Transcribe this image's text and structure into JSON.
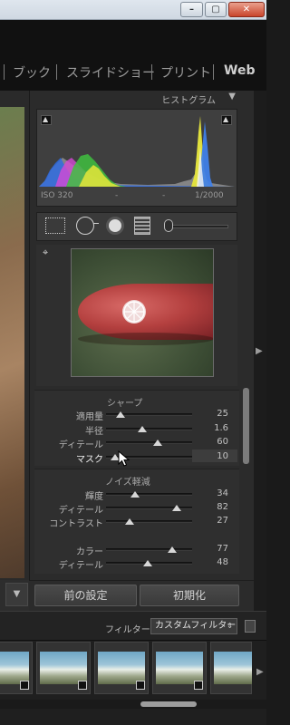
{
  "window": {
    "minimize_glyph": "–",
    "maximize_glyph": "▢",
    "close_glyph": "✕"
  },
  "modules": [
    {
      "label": "ブック"
    },
    {
      "label": "スライドショー"
    },
    {
      "label": "プリント"
    },
    {
      "label": "Web"
    }
  ],
  "histogram": {
    "title": "ヒストグラム",
    "collapse_glyph": "▼",
    "iso": "ISO 320",
    "focal": "-",
    "aperture": "-",
    "shutter": "1/2000",
    "clip_glyph": "▲"
  },
  "tools": {
    "icons": [
      "crop-icon",
      "spot-removal-icon",
      "red-eye-icon",
      "graduated-filter-icon",
      "adjustment-brush-icon"
    ]
  },
  "detail": {
    "target_glyph": "⌖"
  },
  "sharpen": {
    "title": "シャープ",
    "sliders": [
      {
        "label": "適用量",
        "value": "25",
        "position": 0.17
      },
      {
        "label": "半径",
        "value": "1.6",
        "position": 0.42
      },
      {
        "label": "ディテール",
        "value": "60",
        "position": 0.6
      },
      {
        "label": "マスク",
        "value": "10",
        "position": 0.1
      }
    ]
  },
  "noise": {
    "title": "ノイズ軽減",
    "sliders": [
      {
        "label": "輝度",
        "value": "34",
        "position": 0.34
      },
      {
        "label": "ディテール",
        "value": "82",
        "position": 0.82
      },
      {
        "label": "コントラスト",
        "value": "27",
        "position": 0.27
      },
      {
        "label": "カラー",
        "value": "77",
        "position": 0.77
      },
      {
        "label": "ディテール",
        "value": "48",
        "position": 0.48
      }
    ]
  },
  "buttons": {
    "previous": "前の設定",
    "reset": "初期化"
  },
  "filter": {
    "label": "フィルター：",
    "selected": "カスタムフィルター"
  },
  "left_dropdown_glyph": "▼",
  "right_arrow_glyph": "▶",
  "colors": {
    "accent": "#cfcfcf",
    "panel": "#2b2b2b"
  }
}
